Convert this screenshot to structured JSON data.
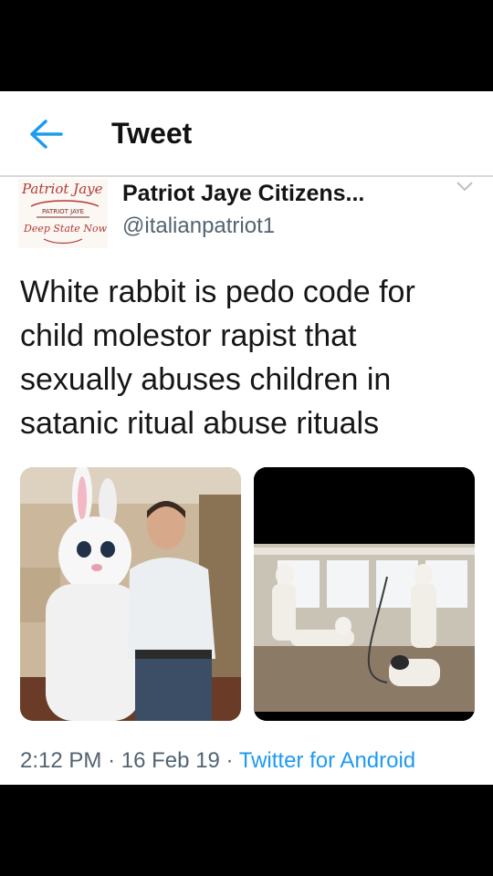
{
  "header": {
    "title": "Tweet",
    "back_icon": "arrow-left-icon"
  },
  "colors": {
    "accent": "#1d9bf0",
    "secondary_text": "#536471",
    "text": "#161616"
  },
  "tweet": {
    "display_name": "Patriot Jaye Citizens...",
    "handle": "@italianpatriot1",
    "avatar_logo": {
      "top_text": "Patriot Jaye",
      "middle_text": "PATRIOT JAYE",
      "bottom_text": "Deep State Now"
    },
    "more_icon": "chevron-down-icon",
    "text": "White rabbit is pedo code for child molestor rapist that sexually abuses children in satanic ritual abuse rituals",
    "photos": [
      {
        "description_icon": "photo-man-with-rabbit-costume"
      },
      {
        "description_icon": "photo-people-in-rabbit-costumes"
      }
    ],
    "time": "2:12 PM",
    "date": "16 Feb 19",
    "source": "Twitter for Android",
    "separator": "·"
  }
}
